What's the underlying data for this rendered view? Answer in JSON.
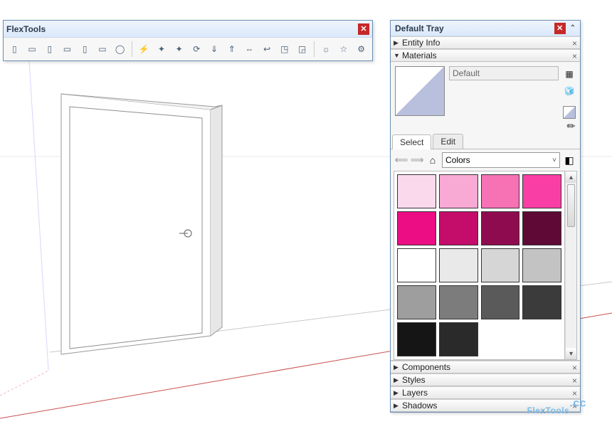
{
  "flextools": {
    "title": "FlexTools",
    "buttons": [
      {
        "name": "door-icon",
        "glyph": "▯"
      },
      {
        "name": "window-icon",
        "glyph": "▭"
      },
      {
        "name": "double-door-icon",
        "glyph": "▯"
      },
      {
        "name": "sliding-door-icon",
        "glyph": "▭"
      },
      {
        "name": "garage-door-icon",
        "glyph": "▯"
      },
      {
        "name": "casement-icon",
        "glyph": "▭"
      },
      {
        "name": "circle-icon",
        "glyph": "◯"
      },
      {
        "name": "sep",
        "glyph": "|"
      },
      {
        "name": "flash-icon",
        "glyph": "⚡"
      },
      {
        "name": "sparkle-icon",
        "glyph": "✦"
      },
      {
        "name": "sparkle2-icon",
        "glyph": "✦"
      },
      {
        "name": "refresh-icon",
        "glyph": "⟳"
      },
      {
        "name": "south-arrow-icon",
        "glyph": "⇓"
      },
      {
        "name": "north-arrow-icon",
        "glyph": "⇑"
      },
      {
        "name": "flip-h-icon",
        "glyph": "⇔"
      },
      {
        "name": "curve-icon",
        "glyph": "↩"
      },
      {
        "name": "box-a-icon",
        "glyph": "◳"
      },
      {
        "name": "box-b-icon",
        "glyph": "◲"
      },
      {
        "name": "sep",
        "glyph": "|"
      },
      {
        "name": "hand-icon",
        "glyph": "☼"
      },
      {
        "name": "star-icon",
        "glyph": "☆"
      },
      {
        "name": "gear-icon",
        "glyph": "⚙"
      }
    ]
  },
  "tray": {
    "title": "Default Tray",
    "panels_collapsed": [
      {
        "title": "Entity Info"
      },
      {
        "title": "Components"
      },
      {
        "title": "Styles"
      },
      {
        "title": "Layers"
      },
      {
        "title": "Shadows"
      }
    ],
    "materials": {
      "title": "Materials",
      "current_name": "Default",
      "tab_select": "Select",
      "tab_edit": "Edit",
      "library": "Colors",
      "swatches": [
        "#fbd9ec",
        "#f8a9d4",
        "#f771b5",
        "#f93fa6",
        "#ec0c84",
        "#c40c6b",
        "#8f0b50",
        "#5f0a36",
        "#ffffff",
        "#e9e9e9",
        "#d6d6d6",
        "#c3c3c3",
        "#9e9e9e",
        "#7c7c7c",
        "#5a5a5a",
        "#3b3b3b",
        "#151515",
        "#2a2a2a"
      ]
    }
  },
  "watermark": {
    "brand": "FlexTools",
    "suffix": ".cc"
  }
}
